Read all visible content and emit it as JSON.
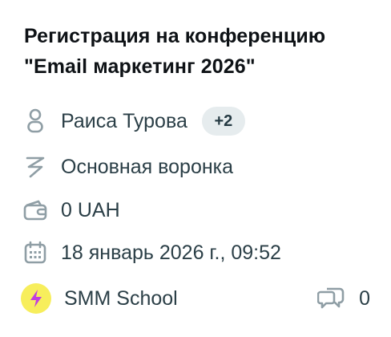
{
  "deal": {
    "title": "Регистрация на конференцию \"Email маркетинг 2026\"",
    "owner": {
      "name": "Раиса Турова",
      "extra_count": "+2"
    },
    "pipeline": "Основная воронка",
    "amount": "0 UAH",
    "date": "18 январь 2026 г., 09:52",
    "source": {
      "name": "SMM School"
    },
    "comments_count": "0"
  },
  "icons": {
    "owner": "person-icon",
    "pipeline": "funnel-icon",
    "amount": "wallet-icon",
    "date": "calendar-icon",
    "source": "lightning-icon",
    "comments": "chat-bubbles-icon"
  },
  "colors": {
    "accent": "#1b97b8",
    "text": "#2b3f47",
    "icon": "#8f9ea5",
    "badge_bg": "#e6ecee",
    "source_avatar_bg": "#f7ee5c",
    "lightning": "#c03ee0"
  }
}
